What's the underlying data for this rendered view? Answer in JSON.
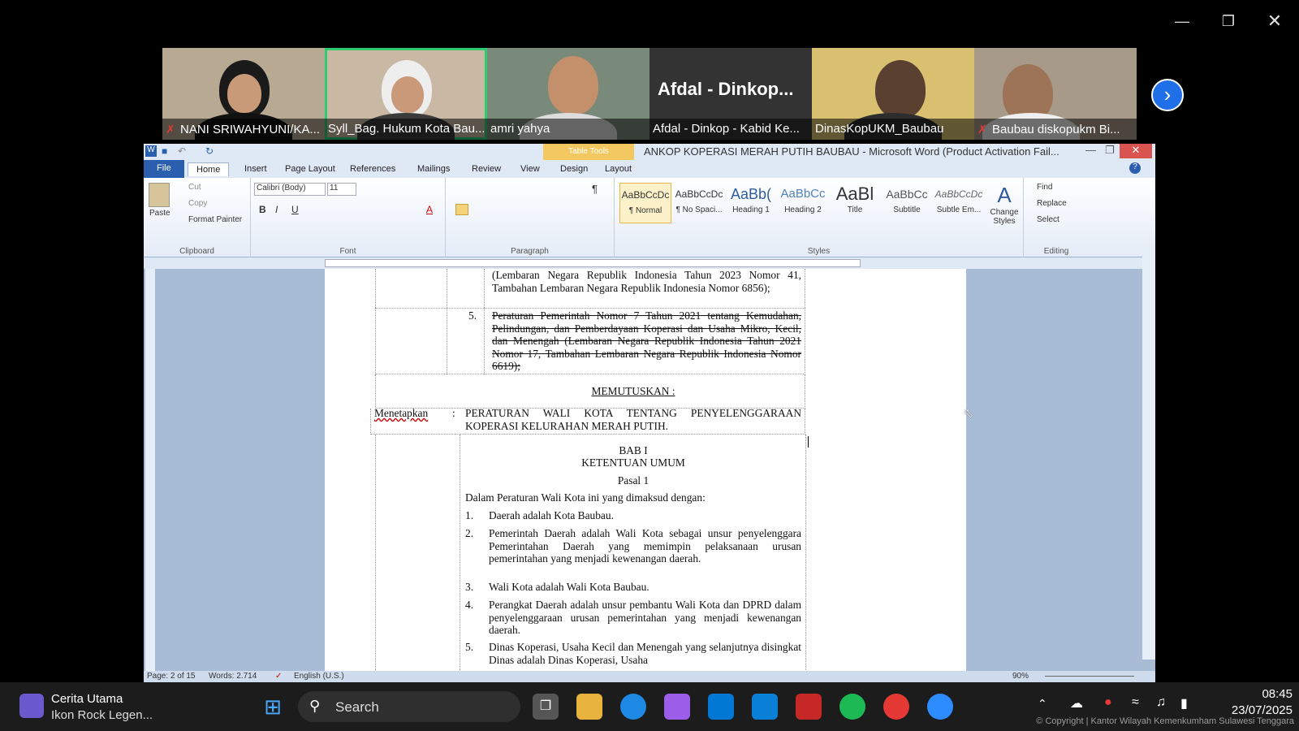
{
  "participants": [
    {
      "name": "NANI SRIWAHYUNI/KA...",
      "muted": true
    },
    {
      "name": "Syll_Bag. Hukum Kota Bau...",
      "muted": false
    },
    {
      "name": "amri yahya",
      "muted": false
    },
    {
      "name": "Afdal - Dinkop - Kabid Ke...",
      "muted": false,
      "big_label": "Afdal - Dinkop..."
    },
    {
      "name": "DinasKopUKM_Baubau",
      "muted": false
    },
    {
      "name": "Baubau diskopukm Bi...",
      "muted": true
    }
  ],
  "word": {
    "window_title": "ANKOP KOPERASI MERAH PUTIH BAUBAU - Microsoft Word (Product Activation Fail...",
    "table_tools": "Table Tools",
    "tabs": [
      "File",
      "Home",
      "Insert",
      "Page Layout",
      "References",
      "Mailings",
      "Review",
      "View",
      "Design",
      "Layout"
    ],
    "clipboard": {
      "paste": "Paste",
      "cut": "Cut",
      "copy": "Copy",
      "format_painter": "Format Painter",
      "label": "Clipboard"
    },
    "font": {
      "name": "Calibri (Body)",
      "size": "11",
      "label": "Font"
    },
    "paragraph_label": "Paragraph",
    "styles": [
      {
        "preview": "AaBbCcDc",
        "label": "¶ Normal"
      },
      {
        "preview": "AaBbCcDc",
        "label": "¶ No Spaci..."
      },
      {
        "preview": "AaBb(",
        "label": "Heading 1"
      },
      {
        "preview": "AaBbCc",
        "label": "Heading 2"
      },
      {
        "preview": "AaBl",
        "label": "Title"
      },
      {
        "preview": "AaBbCc",
        "label": "Subtitle"
      },
      {
        "preview": "AaBbCcDc",
        "label": "Subtle Em..."
      }
    ],
    "styles_label": "Styles",
    "change_styles": "Change Styles",
    "editing": {
      "find": "Find",
      "replace": "Replace",
      "select": "Select",
      "label": "Editing"
    },
    "status": {
      "page": "Page: 2 of 15",
      "words": "Words: 2.714",
      "language": "English (U.S.)",
      "zoom": "90%"
    }
  },
  "doc": {
    "cont_text": "(Lembaran Negara Republik Indonesia Tahun 2023 Nomor 41, Tambahan Lembaran Negara Republik Indonesia Nomor 6856);",
    "item5_num": "5.",
    "item5_text": "Peraturan Pemerintah Nomor 7 Tahun 2021 tentang Kemudahan, Pelindungan, dan Pemberdayaan Koperasi dan Usaha Mikro, Kecil, dan Menengah (Lembaran Negara Republik Indonesia Tahun 2021 Nomor 17, Tambahan Lembaran Negara Republik Indonesia Nomor 6619);",
    "memutuskan": "MEMUTUSKAN :",
    "menetapkan": "Menetapkan",
    "colon": ":",
    "menetapkan_text": "PERATURAN WALI KOTA TENTANG PENYELENGGARAAN KOPERASI KELURAHAN MERAH PUTIH.",
    "bab": "BAB I",
    "bab_title": "KETENTUAN UMUM",
    "pasal": "Pasal 1",
    "intro": "Dalam Peraturan Wali Kota ini yang dimaksud dengan:",
    "items": [
      {
        "n": "1.",
        "t": "Daerah adalah Kota Baubau."
      },
      {
        "n": "2.",
        "t": "Pemerintah Daerah adalah Wali Kota sebagai unsur penyelenggara Pemerintahan Daerah yang memimpin pelaksanaan urusan pemerintahan yang menjadi kewenangan daerah."
      },
      {
        "n": "3.",
        "t": "Wali Kota adalah Wali Kota Baubau."
      },
      {
        "n": "4.",
        "t": "Perangkat Daerah adalah unsur pembantu Wali Kota dan DPRD dalam penyelenggaraan urusan pemerintahan yang menjadi kewenangan daerah."
      },
      {
        "n": "5.",
        "t": "Dinas Koperasi, Usaha Kecil dan Menengah yang selanjutnya disingkat Dinas adalah Dinas Koperasi, Usaha"
      }
    ]
  },
  "taskbar": {
    "news_title": "Cerita Utama",
    "news_sub": "Ikon Rock Legen...",
    "search": "Search",
    "time": "08:45",
    "date": "23/07/2025",
    "watermark": "© Copyright | Kantor Wilayah Kemenkumham Sulawesi Tenggara"
  }
}
